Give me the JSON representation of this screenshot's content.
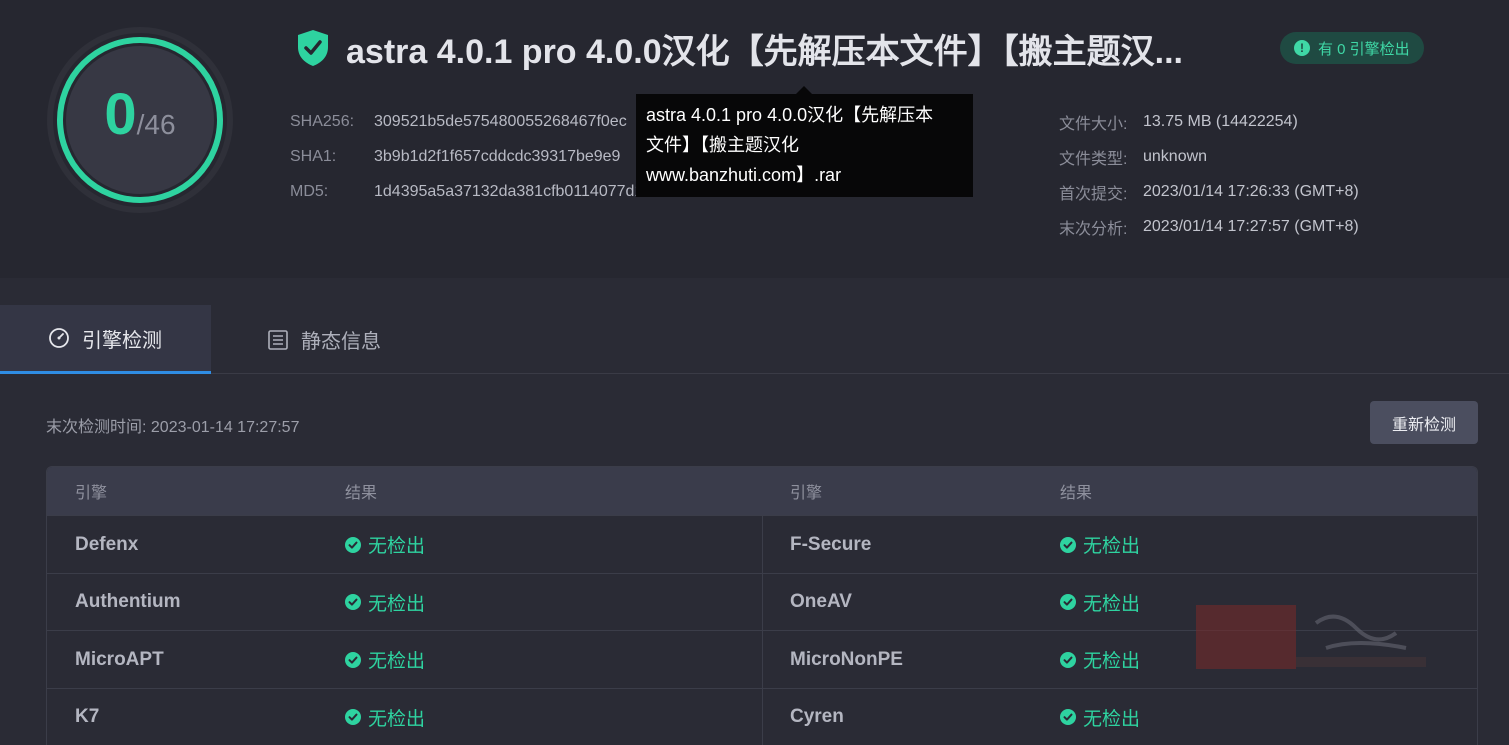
{
  "score": {
    "detected": "0",
    "total": "/46"
  },
  "title": "astra 4.0.1 pro 4.0.0汉化【先解压本文件】【搬主题汉...",
  "badge": "有 0 引擎检出",
  "hashes": [
    {
      "label": "SHA256:",
      "value": "309521b5de575480055268467f0ec"
    },
    {
      "label": "SHA1:",
      "value": "3b9b1d2f1f657cddcdc39317be9e9"
    },
    {
      "label": "MD5:",
      "value": "1d4395a5a37132da381cfb0114077d10"
    }
  ],
  "meta": [
    {
      "label": "文件大小:",
      "value": "13.75 MB (14422254)"
    },
    {
      "label": "文件类型:",
      "value": "unknown"
    },
    {
      "label": "首次提交:",
      "value": "2023/01/14 17:26:33 (GMT+8)"
    },
    {
      "label": "末次分析:",
      "value": "2023/01/14 17:27:57 (GMT+8)"
    }
  ],
  "tooltip": {
    "line1": "astra 4.0.1 pro 4.0.0汉化【先解压本",
    "line2": "文件】【搬主题汉化",
    "line3": "www.banzhuti.com】.rar"
  },
  "tabs": [
    {
      "label": "引擎检测",
      "icon": "gauge-icon"
    },
    {
      "label": "静态信息",
      "icon": "list-icon"
    }
  ],
  "last_scan": "末次检测时间: 2023-01-14 17:27:57",
  "rescan_label": "重新检测",
  "table": {
    "headers": [
      "引擎",
      "结果",
      "引擎",
      "结果"
    ],
    "rows": [
      {
        "left_engine": "Defenx",
        "left_result": "无检出",
        "right_engine": "F-Secure",
        "right_result": "无检出"
      },
      {
        "left_engine": "Authentium",
        "left_result": "无检出",
        "right_engine": "OneAV",
        "right_result": "无检出"
      },
      {
        "left_engine": "MicroAPT",
        "left_result": "无检出",
        "right_engine": "MicroNonPE",
        "right_result": "无检出"
      },
      {
        "left_engine": "K7",
        "left_result": "无检出",
        "right_engine": "Cyren",
        "right_result": "无检出"
      }
    ]
  },
  "colors": {
    "accent": "#2ed3a0",
    "tab_active": "#2f8de4"
  }
}
